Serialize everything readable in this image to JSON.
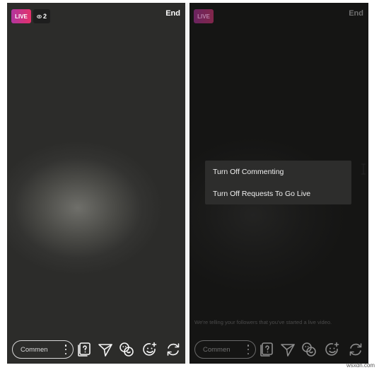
{
  "left_panel": {
    "live_label": "LIVE",
    "viewer_count": "2",
    "end_label": "End",
    "comment_placeholder": "Commen"
  },
  "right_panel": {
    "live_label": "LIVE",
    "end_label": "End",
    "comment_placeholder": "Commen",
    "menu_items": [
      {
        "label": "Turn Off Commenting"
      },
      {
        "label": "Turn Off Requests To Go Live"
      }
    ],
    "status_notice": "We're telling your followers that you've started a live video."
  },
  "watermark": "wsxdn.com",
  "toolbar_icons": [
    "question-sticker-icon",
    "send-icon",
    "guest-request-icon",
    "face-filter-icon",
    "switch-camera-icon"
  ],
  "colors": {
    "live_gradient_start": "#b1369f",
    "live_gradient_end": "#e4316b",
    "menu_background": "#2d2d2c"
  }
}
